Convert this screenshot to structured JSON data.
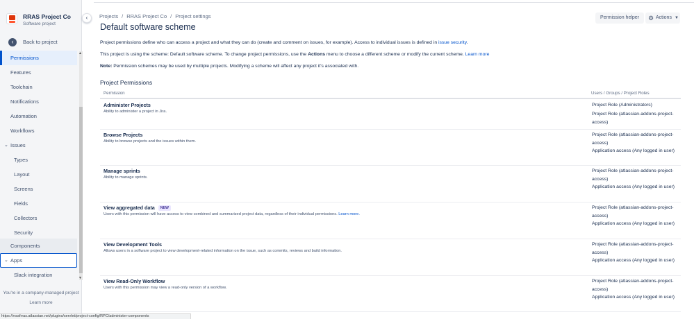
{
  "sidebar": {
    "project_name": "RRAS Project Co",
    "project_type": "Software project",
    "back_label": "Back to project",
    "items": [
      {
        "label": "Permissions"
      },
      {
        "label": "Features"
      },
      {
        "label": "Toolchain"
      },
      {
        "label": "Notifications"
      },
      {
        "label": "Automation"
      },
      {
        "label": "Workflows"
      },
      {
        "label": "Issues"
      },
      {
        "label": "Types"
      },
      {
        "label": "Layout"
      },
      {
        "label": "Screens"
      },
      {
        "label": "Fields"
      },
      {
        "label": "Collectors"
      },
      {
        "label": "Security"
      },
      {
        "label": "Components"
      },
      {
        "label": "Apps"
      },
      {
        "label": "Slack integration"
      }
    ],
    "footer_text": "You're in a company-managed project",
    "footer_link": "Learn more"
  },
  "breadcrumb": [
    "Projects",
    "RRAS Project Co",
    "Project settings"
  ],
  "page_title": "Default software scheme",
  "header_buttons": {
    "permission_helper": "Permission helper",
    "actions": "Actions"
  },
  "intro": {
    "p1_text": "Project permissions define who can access a project and what they can do (create and comment on issues, for example). Access to individual issues is defined in ",
    "p1_link": "issue security",
    "p1_end": ".",
    "p2_start": "This project is using the scheme: Default software scheme. To change project permissions, use the ",
    "p2_bold": "Actions",
    "p2_mid": " menu to choose a different scheme or modify the current scheme. ",
    "p2_link": "Learn more",
    "p3_bold": "Note:",
    "p3_text": " Permission schemes may be used by multiple projects. Modifying a scheme will affect any project it's associated with."
  },
  "section_heading": "Project Permissions",
  "table": {
    "col_permission": "Permission",
    "col_grants": "Users / Groups / Project Roles",
    "rows": [
      {
        "name": "Administer Projects",
        "desc": "Ability to administer a project in Jira.",
        "grants": [
          "Project Role (Administrators)",
          "Project Role (atlassian-addons-project-access)"
        ]
      },
      {
        "name": "Browse Projects",
        "desc": "Ability to browse projects and the issues within them.",
        "grants": [
          "Project Role (atlassian-addons-project-access)",
          "Application access (Any logged in user)"
        ]
      },
      {
        "name": "Manage sprints",
        "desc": "Ability to manage sprints.",
        "grants": [
          "Project Role (atlassian-addons-project-access)",
          "Application access (Any logged in user)"
        ]
      },
      {
        "name": "View aggregated data",
        "badge": "NEW",
        "desc": "Users with this permission will have access to view combined and summarized project data, regardless of their individual permissions. ",
        "desc_link": "Learn more.",
        "grants": [
          "Project Role (atlassian-addons-project-access)",
          "Application access (Any logged in user)"
        ]
      },
      {
        "name": "View Development Tools",
        "desc": "Allows users in a software project to view development-related information on the issue, such as commits, reviews and build information.",
        "grants": [
          "Project Role (atlassian-addons-project-access)",
          "Application access (Any logged in user)"
        ]
      },
      {
        "name": "View Read-Only Workflow",
        "desc": "Users with this permission may view a read-only version of a workflow.",
        "grants": [
          "Project Role (atlassian-addons-project-access)",
          "Application access (Any logged in user)"
        ]
      }
    ]
  },
  "status_url": "https://rrasfrras.atlassian.net/plugins/servlet/project-config/RPC/administer-components",
  "colors": {
    "accent": "#0052cc",
    "sidebar_bg": "#f4f5f7",
    "selected_bg": "#e6effc",
    "text": "#172b4d"
  }
}
